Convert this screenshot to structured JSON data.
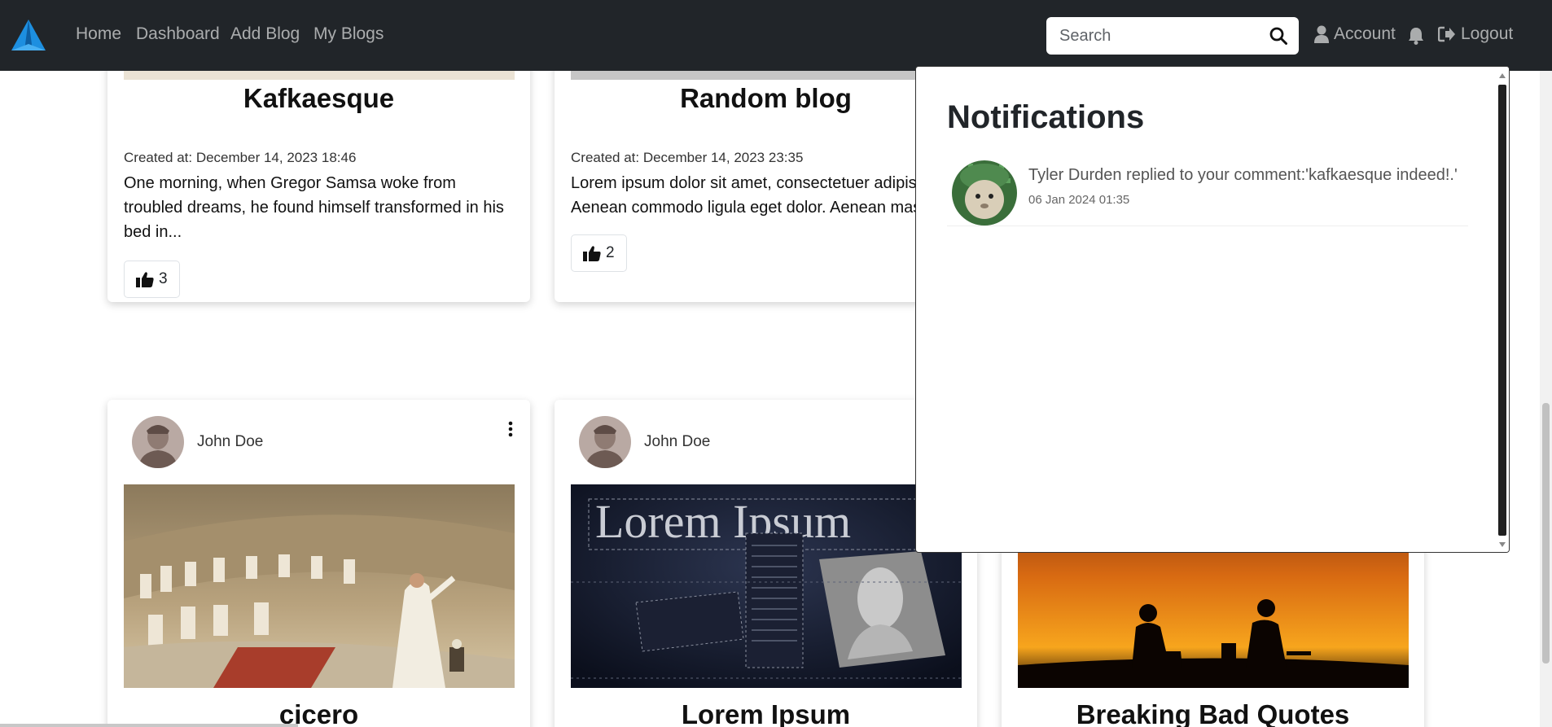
{
  "nav": {
    "links": [
      "Home",
      "Dashboard",
      "Add Blog",
      "My Blogs"
    ],
    "search_placeholder": "Search",
    "account_label": "Account",
    "logout_label": "Logout"
  },
  "top_cards": [
    {
      "title": "Kafkaesque",
      "created_at": "Created at: December 14, 2023 18:46",
      "excerpt": "One morning, when Gregor Samsa woke from troubled dreams, he found himself transformed in his bed in...",
      "likes": "3"
    },
    {
      "title": "Random blog",
      "created_at": "Created at: December 14, 2023 23:35",
      "excerpt": "Lorem ipsum dolor sit amet, consectetuer adipiscing elit. Aenean commodo ligula eget dolor. Aenean massa.",
      "likes": "2"
    }
  ],
  "bottom_cards": [
    {
      "author": "John Doe",
      "title": "cicero"
    },
    {
      "author": "John Doe",
      "title": "Lorem Ipsum",
      "image_text": "Lorem Ipsum"
    },
    {
      "title": "Breaking Bad Quotes"
    }
  ],
  "notifications": {
    "heading": "Notifications",
    "items": [
      {
        "text": "Tyler Durden replied to your comment:'kafkaesque indeed!.'",
        "time": "06 Jan 2024 01:35"
      }
    ]
  },
  "colors": {
    "navbar_bg": "#212529",
    "logo_blue": "#1d8fe0"
  }
}
